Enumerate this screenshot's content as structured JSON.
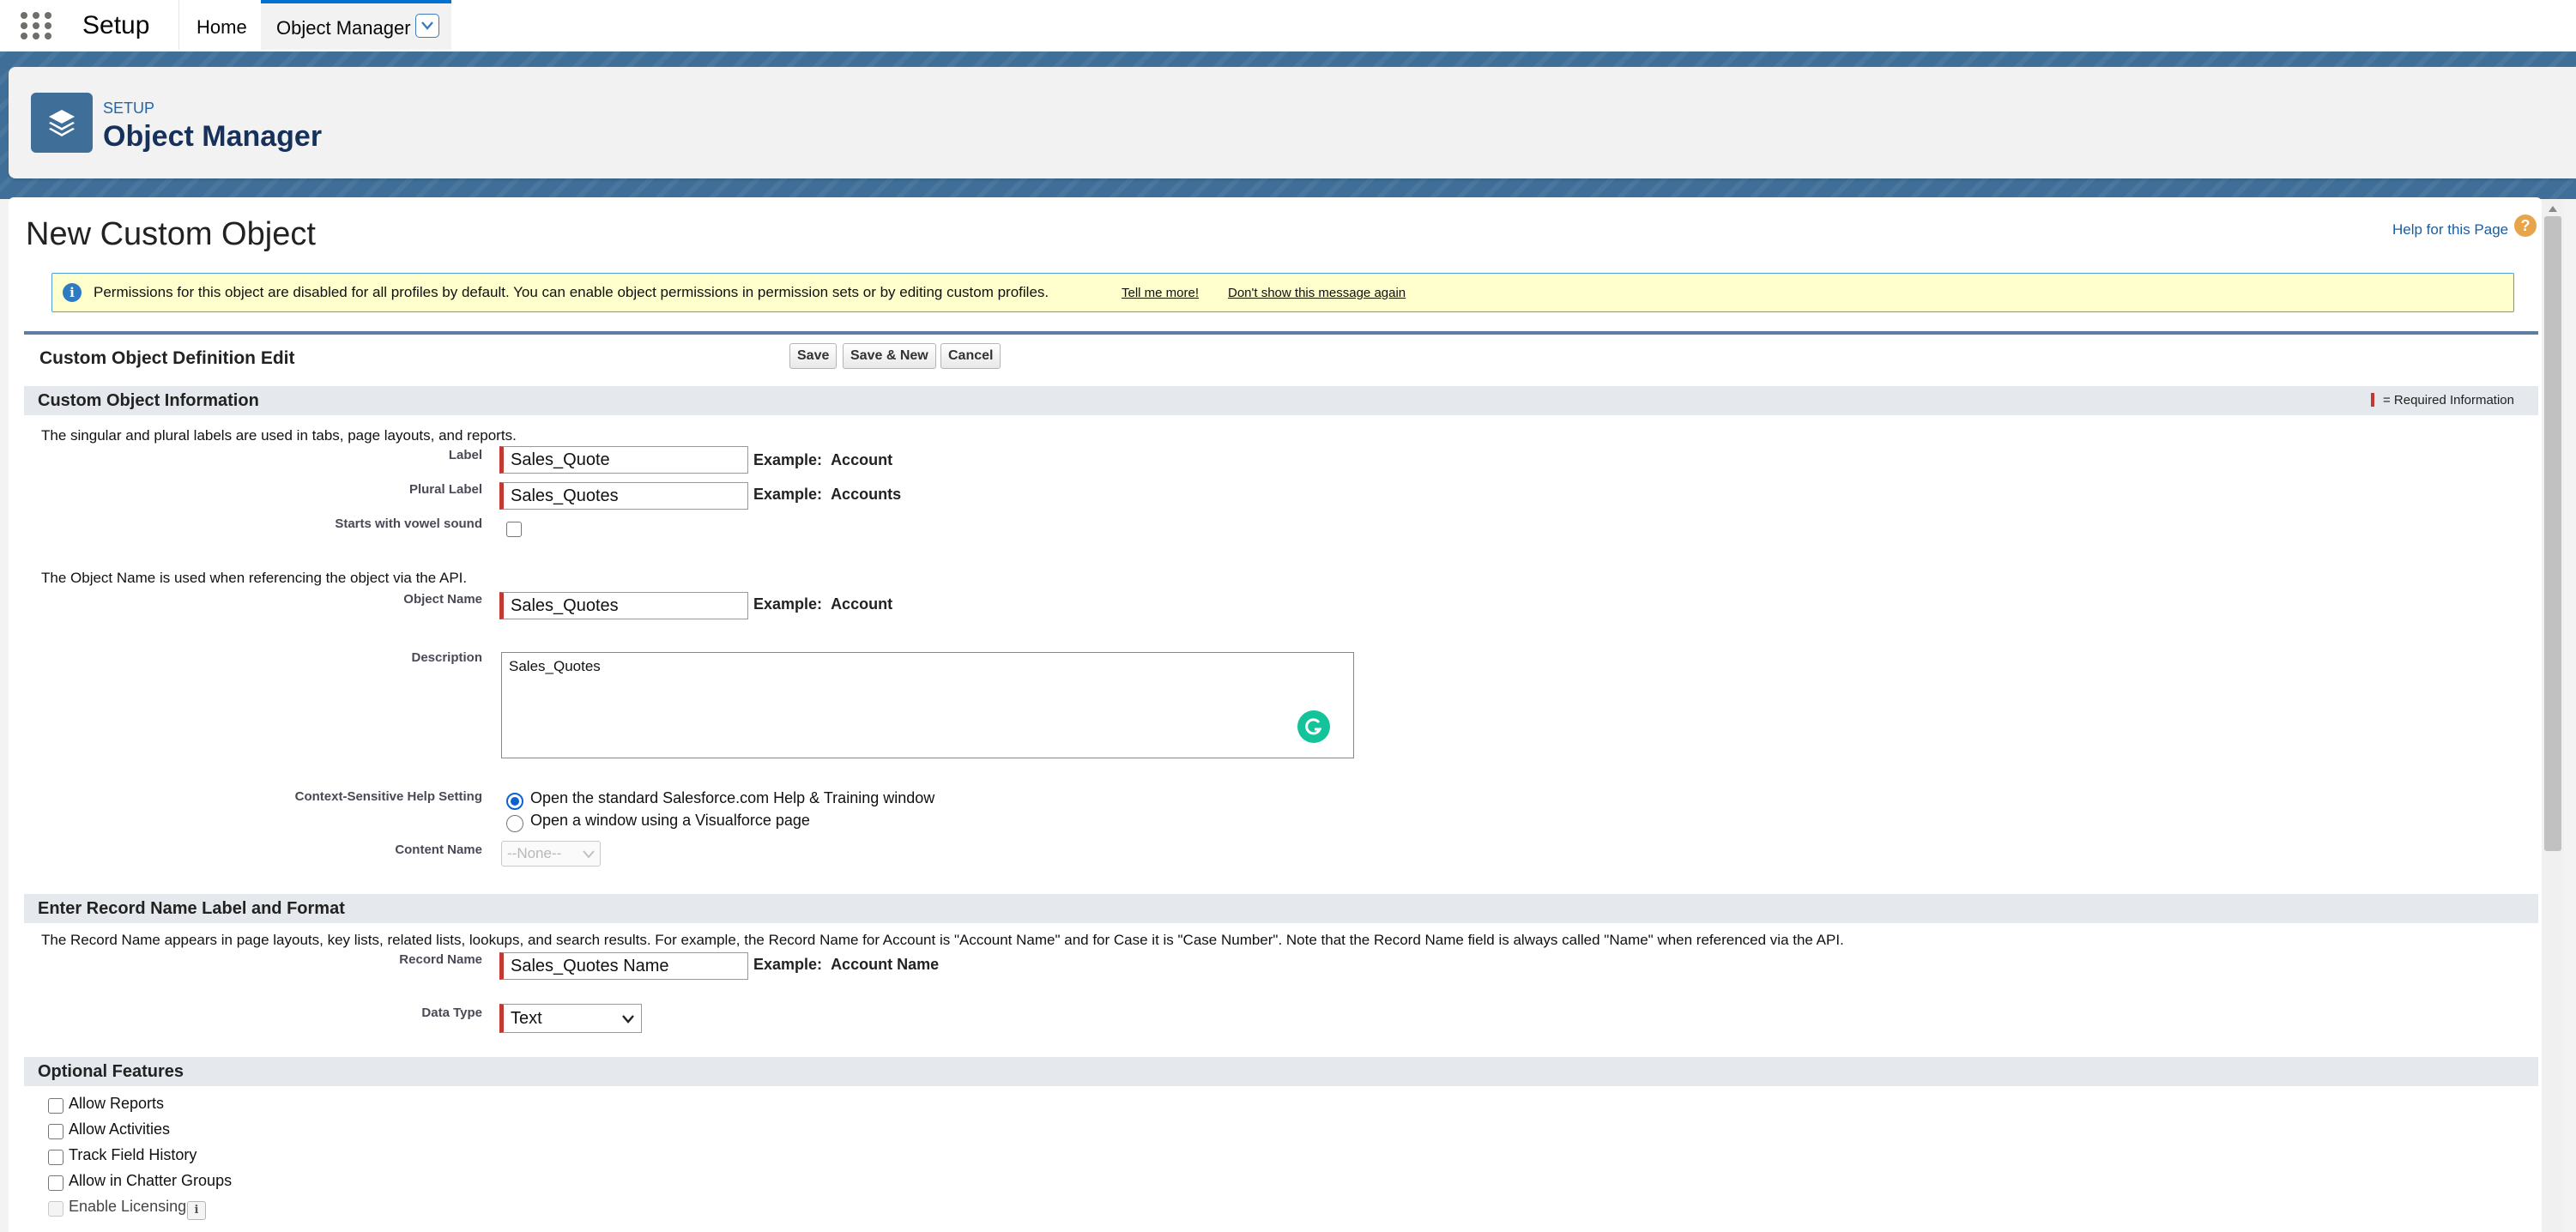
{
  "nav": {
    "app_name": "Setup",
    "tabs": [
      {
        "label": "Home"
      },
      {
        "label": "Object Manager"
      }
    ]
  },
  "header": {
    "eyebrow": "SETUP",
    "title": "Object Manager",
    "icon": "layers-icon"
  },
  "page": {
    "title": "New Custom Object",
    "help_link": "Help for this Page",
    "help_icon": "question-icon"
  },
  "banner": {
    "text": "Permissions for this object are disabled for all profiles by default. You can enable object permissions in permission sets or by editing custom profiles.",
    "tell_me_more": "Tell me more!",
    "dont_show": "Don't show this message again"
  },
  "edit": {
    "title": "Custom Object Definition Edit",
    "save_label": "Save",
    "save_new_label": "Save & New",
    "cancel_label": "Cancel"
  },
  "sections": {
    "info": {
      "title": "Custom Object Information",
      "required_legend": "= Required Information",
      "labels_help": "The singular and plural labels are used in tabs, page layouts, and reports.",
      "object_name_help": "The Object Name is used when referencing the object via the API."
    },
    "record_name": {
      "title": "Enter Record Name Label and Format",
      "help": "The Record Name appears in page layouts, key lists, related lists, lookups, and search results. For example, the Record Name for Account is \"Account Name\" and for Case it is \"Case Number\". Note that the Record Name field is always called \"Name\" when referenced via the API."
    },
    "optional": {
      "title": "Optional Features"
    }
  },
  "fields": {
    "label": {
      "label": "Label",
      "value": "Sales_Quote",
      "example_prefix": "Example:",
      "example": "Account"
    },
    "plural_label": {
      "label": "Plural Label",
      "value": "Sales_Quotes",
      "example_prefix": "Example:",
      "example": "Accounts"
    },
    "vowel": {
      "label": "Starts with vowel sound",
      "checked": false
    },
    "object_name": {
      "label": "Object Name",
      "value": "Sales_Quotes",
      "example_prefix": "Example:",
      "example": "Account"
    },
    "description": {
      "label": "Description",
      "value": "Sales_Quotes"
    },
    "help_setting": {
      "label": "Context-Sensitive Help Setting",
      "options": [
        "Open the standard Salesforce.com Help & Training window",
        "Open a window using a Visualforce page"
      ],
      "selected_index": 0
    },
    "content_name": {
      "label": "Content Name",
      "value": "--None--"
    },
    "record_name": {
      "label": "Record Name",
      "value": "Sales_Quotes Name",
      "example_prefix": "Example:",
      "example": "Account Name"
    },
    "data_type": {
      "label": "Data Type",
      "value": "Text"
    }
  },
  "optional_features": [
    {
      "label": "Allow Reports",
      "checked": false,
      "disabled": false
    },
    {
      "label": "Allow Activities",
      "checked": false,
      "disabled": false
    },
    {
      "label": "Track Field History",
      "checked": false,
      "disabled": false
    },
    {
      "label": "Allow in Chatter Groups",
      "checked": false,
      "disabled": false
    },
    {
      "label": "Enable Licensing",
      "checked": false,
      "disabled": true
    }
  ],
  "colors": {
    "required": "#c23934",
    "brand": "#3f6f98",
    "link": "#1a5ea6",
    "banner_bg": "#feffcd"
  }
}
